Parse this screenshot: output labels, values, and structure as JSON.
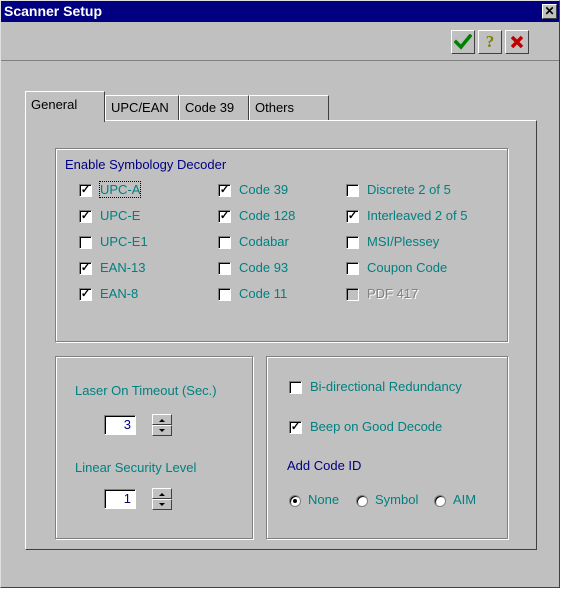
{
  "window": {
    "title": "Scanner Setup",
    "close_glyph": "✕"
  },
  "toolbar": {
    "ok_icon": "green-check-icon",
    "help_icon": "help-question-icon",
    "cancel_icon": "red-x-icon",
    "help_glyph": "?",
    "colors": {
      "ok": "#008000",
      "help": "#808000",
      "cancel": "#c00000"
    }
  },
  "tabs": [
    {
      "label": "General",
      "active": true
    },
    {
      "label": "UPC/EAN",
      "active": false
    },
    {
      "label": "Code 39",
      "active": false
    },
    {
      "label": "Others",
      "active": false
    }
  ],
  "symbology": {
    "title": "Enable Symbology Decoder",
    "items": [
      {
        "label": "UPC-A",
        "checked": true,
        "enabled": true
      },
      {
        "label": "UPC-E",
        "checked": true,
        "enabled": true
      },
      {
        "label": "UPC-E1",
        "checked": false,
        "enabled": true
      },
      {
        "label": "EAN-13",
        "checked": true,
        "enabled": true
      },
      {
        "label": "EAN-8",
        "checked": true,
        "enabled": true
      },
      {
        "label": "Code 39",
        "checked": true,
        "enabled": true
      },
      {
        "label": "Code 128",
        "checked": true,
        "enabled": true
      },
      {
        "label": "Codabar",
        "checked": false,
        "enabled": true
      },
      {
        "label": "Code 93",
        "checked": false,
        "enabled": true
      },
      {
        "label": "Code 11",
        "checked": false,
        "enabled": true
      },
      {
        "label": "Discrete 2 of 5",
        "checked": false,
        "enabled": true
      },
      {
        "label": "Interleaved 2 of 5",
        "checked": true,
        "enabled": true
      },
      {
        "label": "MSI/Plessey",
        "checked": false,
        "enabled": true
      },
      {
        "label": "Coupon Code",
        "checked": false,
        "enabled": true
      },
      {
        "label": "PDF 417",
        "checked": false,
        "enabled": false
      }
    ]
  },
  "laser": {
    "label": "Laser On Timeout (Sec.)",
    "value": "3"
  },
  "security": {
    "label": "Linear Security Level",
    "value": "1"
  },
  "options": {
    "bidirectional": {
      "label": "Bi-directional Redundancy",
      "checked": false
    },
    "beep": {
      "label": "Beep on Good Decode",
      "checked": true
    },
    "code_id_label": "Add Code ID",
    "code_id_options": [
      {
        "label": "None",
        "selected": true
      },
      {
        "label": "Symbol",
        "selected": false
      },
      {
        "label": "AIM",
        "selected": false
      }
    ]
  },
  "colors": {
    "title_bar": "#000080",
    "label_text": "#008080",
    "group_title": "#000080",
    "face": "#c0c0c0"
  }
}
